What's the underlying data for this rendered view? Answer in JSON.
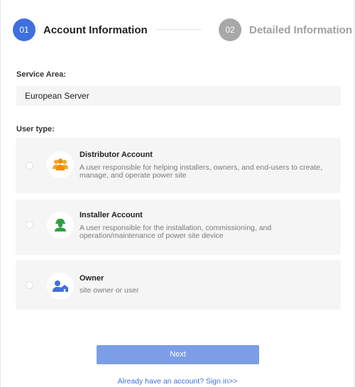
{
  "stepper": {
    "steps": [
      {
        "number": "01",
        "label": "Account Information",
        "state": "active",
        "color": "#3f6fe0"
      },
      {
        "number": "02",
        "label": "Detailed Information",
        "state": "inactive",
        "color": "#a8a8a8"
      }
    ]
  },
  "service_area": {
    "label": "Service Area:",
    "value": "European Server"
  },
  "user_type": {
    "label": "User type:",
    "options": [
      {
        "title": "Distributor Account",
        "description": "A user responsible for helping installers, owners, and end-users to create, manage, and operate power site",
        "icon": "distributor-group-icon",
        "selected": false
      },
      {
        "title": "Installer Account",
        "description": "A user responsible for the installation, commissioning, and operation/maintenance of power site device",
        "icon": "installer-worker-icon",
        "selected": false
      },
      {
        "title": "Owner",
        "description": "site owner or user",
        "icon": "owner-home-icon",
        "selected": false
      }
    ]
  },
  "actions": {
    "next_label": "Next",
    "signin_text": "Already have an account? Sign in>>"
  },
  "colors": {
    "primary": "#3f6fe0",
    "button": "#7b9ee7",
    "distributor_icon": "#f5a623",
    "installer_icon": "#2f9e44",
    "owner_icon": "#3f6fe0"
  }
}
